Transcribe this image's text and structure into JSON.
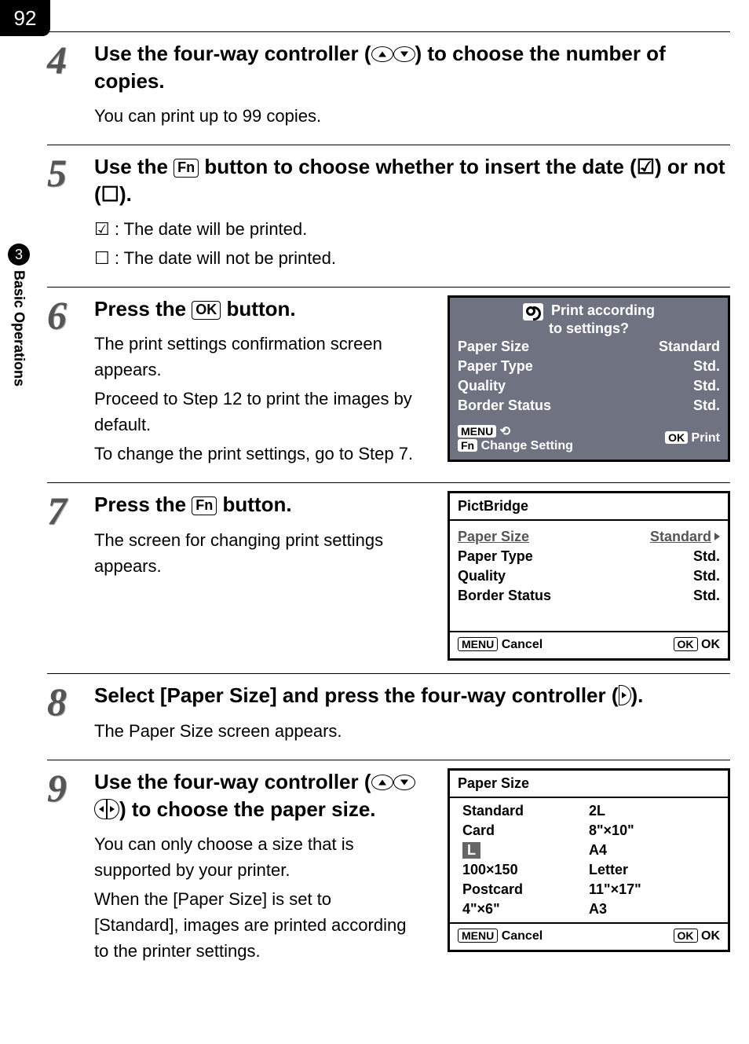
{
  "page_number": "92",
  "side_tab": {
    "section_number": "3",
    "label": "Basic Operations"
  },
  "steps": {
    "s4": {
      "num": "4",
      "title_a": "Use the four-way controller (",
      "title_b": ") to choose the number of copies.",
      "body": "You can print up to 99 copies."
    },
    "s5": {
      "num": "5",
      "title_a": "Use the ",
      "fn": "Fn",
      "title_b": " button to choose whether to insert the date (",
      "title_c": ") or not (",
      "title_d": ").",
      "line1": " : The date will be printed.",
      "line2": " : The date will not be printed."
    },
    "s6": {
      "num": "6",
      "title_a": "Press the ",
      "ok": "OK",
      "title_b": " button.",
      "p1": "The print settings confirmation screen appears.",
      "p2": "Proceed to Step 12 to print the images by default.",
      "p3": "To change the print settings, go to Step 7."
    },
    "s7": {
      "num": "7",
      "title_a": "Press the ",
      "fn": "Fn",
      "title_b": " button.",
      "p1": "The screen for changing print settings appears."
    },
    "s8": {
      "num": "8",
      "title": "Select [Paper Size] and press the four-way controller (",
      "title_b": ").",
      "p1": "The Paper Size screen appears."
    },
    "s9": {
      "num": "9",
      "title_a": "Use the four-way controller (",
      "title_b": ") to choose the paper size.",
      "p1": "You can only choose a size that is supported by your printer.",
      "p2": "When the [Paper Size] is set to [Standard], images are printed according to the printer settings."
    }
  },
  "lcd1": {
    "header1": "Print according",
    "header2": "to settings?",
    "rows": [
      [
        "Paper Size",
        "Standard"
      ],
      [
        "Paper Type",
        "Std."
      ],
      [
        "Quality",
        "Std."
      ],
      [
        "Border Status",
        "Std."
      ]
    ],
    "menu": "MENU",
    "fn": "Fn",
    "change": "Change Setting",
    "ok": "OK",
    "print": "Print"
  },
  "lcd2": {
    "title": "PictBridge",
    "rows": [
      [
        "Paper Size",
        "Standard"
      ],
      [
        "Paper Type",
        "Std."
      ],
      [
        "Quality",
        "Std."
      ],
      [
        "Border Status",
        "Std."
      ]
    ],
    "menu": "MENU",
    "cancel": "Cancel",
    "ok": "OK",
    "ok2": "OK"
  },
  "lcd3": {
    "title": "Paper Size",
    "col1": [
      "Standard",
      "Card",
      "L",
      "100×150",
      "Postcard",
      "4\"×6\""
    ],
    "col2": [
      "2L",
      "8\"×10\"",
      "A4",
      "Letter",
      "11\"×17\"",
      "A3"
    ],
    "menu": "MENU",
    "cancel": "Cancel",
    "ok": "OK",
    "ok2": "OK"
  }
}
